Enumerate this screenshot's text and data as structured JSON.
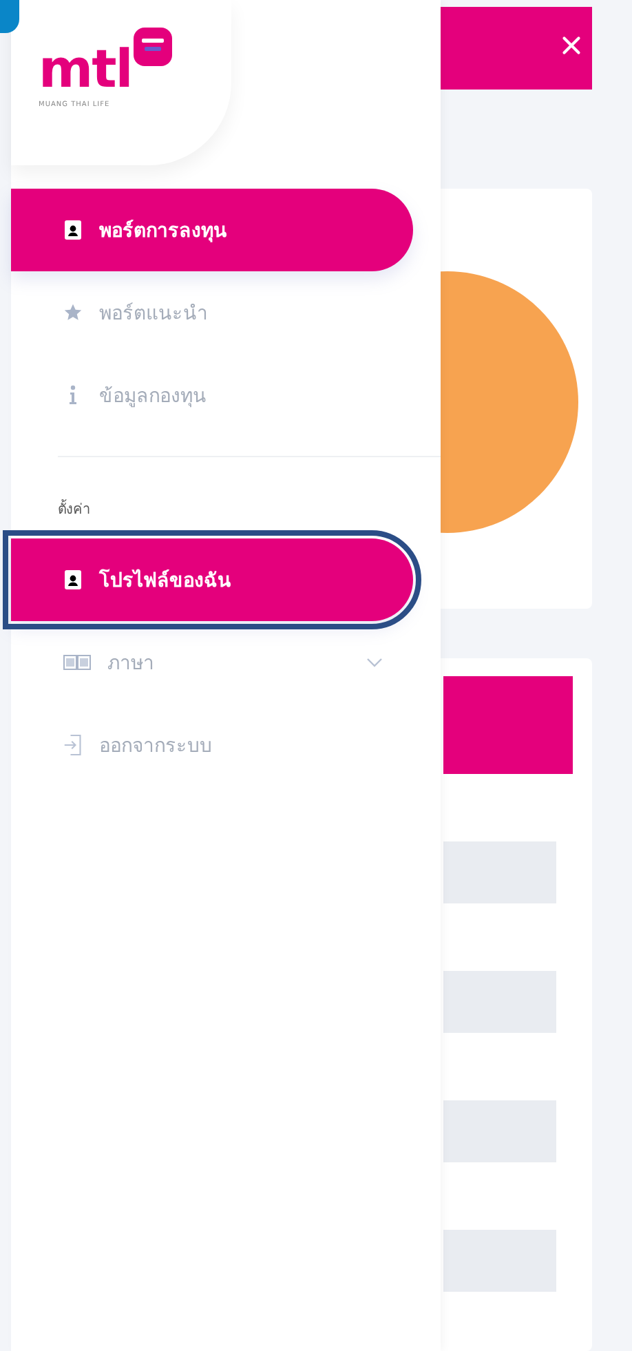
{
  "logo": {
    "wordmark": "mtl",
    "tagline": "MUANG THAI LIFE"
  },
  "menu": [
    {
      "kind": "link",
      "label": "พอร์ตการลงทุน",
      "selected": true,
      "highlighted": false
    },
    {
      "kind": "link",
      "label": "พอร์ตแนะนำ",
      "selected": false,
      "highlighted": false
    },
    {
      "kind": "link",
      "label": "ข้อมูลกองทุน",
      "selected": false,
      "highlighted": false
    }
  ],
  "settings": {
    "label": "ตั้งค่า",
    "items": [
      {
        "kind": "link",
        "label": "โปรไฟล์ของฉัน",
        "selected": true,
        "highlighted": true
      },
      {
        "kind": "dropdown",
        "label": "ภาษา",
        "selected": false,
        "highlighted": false,
        "expanded": false
      },
      {
        "kind": "link",
        "label": "ออกจากระบบ",
        "selected": false,
        "highlighted": false
      }
    ]
  }
}
